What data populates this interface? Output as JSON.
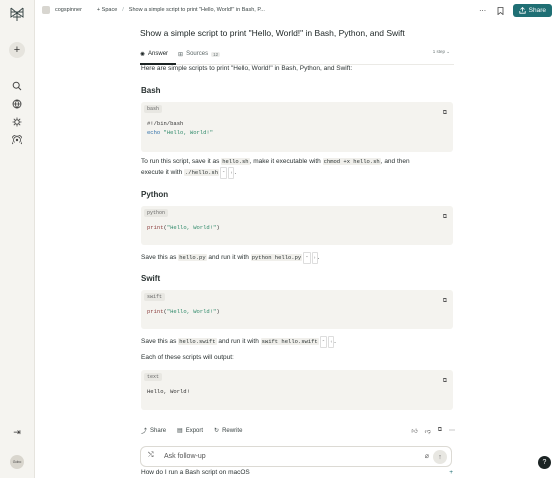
{
  "sidebar": {
    "logo_icon": "perplexity-logo",
    "new_thread_icon": "plus-icon",
    "nav_icons": [
      "search-icon",
      "globe-icon",
      "spaces-icon",
      "signal-icon"
    ],
    "collapse_icon": "arrow-right-bar-icon",
    "avatar_label": "Gobo"
  },
  "header": {
    "workspace": "cogspinner",
    "space_label": "+ Space",
    "separator": "/",
    "thread_title": "Show a simple script to print \"Hello, World!\" in Bash, P...",
    "share_label": "Share",
    "accent": "#1f6f74"
  },
  "thread": {
    "question": "Show a simple script to print \"Hello, World!\" in Bash, Python, and Swift",
    "tabs": [
      {
        "label": "Answer"
      },
      {
        "label": "Sources",
        "count": "12"
      }
    ],
    "steps": "1 step",
    "intro": "Here are simple scripts to print \"Hello, World!\" in Bash, Python, and Swift:",
    "bash": {
      "heading": "Bash",
      "lang": "bash",
      "line1": "#!/bin/bash",
      "line2_kw": "echo",
      "line2_str": "\"Hello, World!\"",
      "para_a": "To run this script, save it as ",
      "file": "hello.sh",
      "para_b": ", make it executable with ",
      "cmd1": "chmod +x hello.sh",
      "para_c": ", and then",
      "para_d": "execute it with ",
      "cmd2": "./hello.sh",
      "para_e": "."
    },
    "python": {
      "heading": "Python",
      "lang": "python",
      "fn": "print",
      "arg": "\"Hello, World!\"",
      "para_a": "Save this as ",
      "file": "hello.py",
      "para_b": " and run it with ",
      "cmd": "python hello.py",
      "para_c": "."
    },
    "swift": {
      "heading": "Swift",
      "lang": "swift",
      "fn": "print",
      "arg": "\"Hello, World!\"",
      "para_a": "Save this as ",
      "file": "hello.swift",
      "para_b": " and run it with ",
      "cmd": "swift hello.swift",
      "para_c": "."
    },
    "output_intro": "Each of these scripts will output:",
    "output": {
      "lang": "text",
      "line": "Hello, World!"
    },
    "actions": {
      "share": "Share",
      "export": "Export",
      "rewrite": "Rewrite"
    }
  },
  "ask": {
    "placeholder": "Ask follow-up"
  },
  "related": {
    "first": "How do I run a Bash script on macOS"
  }
}
